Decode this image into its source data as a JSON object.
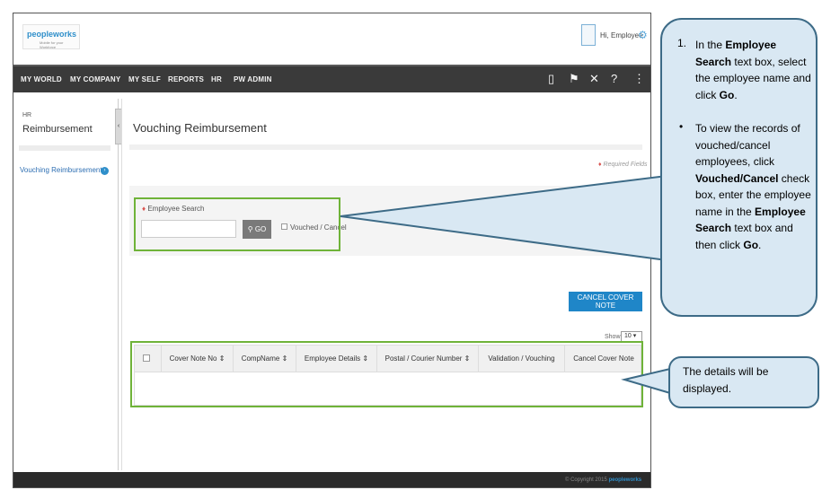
{
  "header": {
    "logo_text": "peopleworks",
    "logo_tagline": "Mobile for your Workforce",
    "greeting": "Hi, Employee"
  },
  "nav": {
    "items": [
      "MY WORLD",
      "MY COMPANY",
      "MY SELF",
      "REPORTS",
      "HR",
      "PW ADMIN"
    ],
    "icons": [
      "book-icon",
      "flag-icon",
      "tools-icon",
      "help-icon",
      "share-icon"
    ]
  },
  "sidebar": {
    "section_small": "HR",
    "section_title": "Reimbursement",
    "items": [
      {
        "label": "Vouching Reimbursement"
      }
    ]
  },
  "main": {
    "title": "Vouching Reimbursement",
    "required_note": "Required Fields",
    "search": {
      "label": "Employee Search",
      "value": "",
      "go_label": "GO",
      "vouched_label": "Vouched / Cancel"
    },
    "cancel_button": "CANCEL COVER NOTE",
    "show_label": "Show",
    "show_value": "10",
    "table": {
      "columns": [
        "Cover Note No",
        "CompName",
        "Employee Details",
        "Postal / Courier Number",
        "Validation / Vouching",
        "Cancel Cover Note"
      ]
    }
  },
  "footer": {
    "copyright": "© Copyright 2015",
    "brand": "peopleworks"
  },
  "callouts": {
    "step1": {
      "num": "1.",
      "pre": "In the ",
      "b1": "Employee Search",
      "mid": " text box, select the employee name and click ",
      "b2": "Go",
      "post": "."
    },
    "step2": {
      "pre": "To view the records of vouched/cancel employees, click ",
      "b1": "Vouched/Cancel",
      "mid": " check box, enter the employee name in the ",
      "b2": "Employee Search",
      "mid2": " text box and then click ",
      "b3": "Go",
      "post": "."
    },
    "details": "The details will be displayed."
  },
  "colors": {
    "highlight": "#6fb339",
    "callout_fill": "#d9e8f3",
    "callout_border": "#3d6b87",
    "navbar": "#3a3a3a",
    "accent": "#1f86c8"
  }
}
